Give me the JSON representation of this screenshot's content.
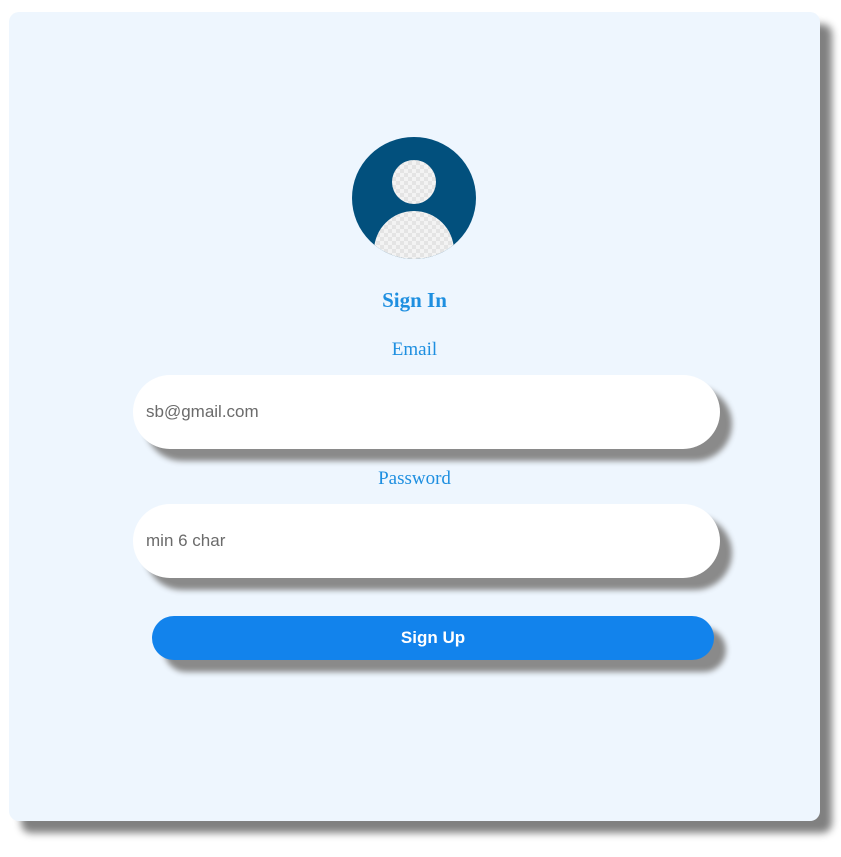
{
  "form": {
    "title": "Sign In",
    "email_label": "Email",
    "email_placeholder": "sb@gmail.com",
    "password_label": "Password",
    "password_placeholder": "min 6 char",
    "submit_label": "Sign Up"
  },
  "icons": {
    "avatar": "user-avatar-icon"
  },
  "colors": {
    "card_background": "#eef6fe",
    "accent": "#1e8fe0",
    "button": "#1283ec",
    "avatar": "#02507d"
  }
}
